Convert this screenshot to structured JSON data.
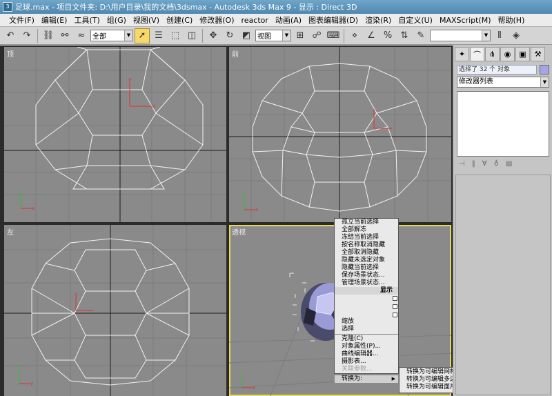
{
  "window": {
    "title": "足球.max    - 项目文件夹: D:\\用户目录\\我的文档\\3dsmax    - Autodesk 3ds Max 9    - 显示 : Direct 3D"
  },
  "menubar": {
    "items": [
      "文件(F)",
      "编辑(E)",
      "工具(T)",
      "组(G)",
      "视图(V)",
      "创建(C)",
      "修改器(O)",
      "reactor",
      "动画(A)",
      "图表编辑器(D)",
      "渲染(R)",
      "自定义(U)",
      "MAXScript(M)",
      "帮助(H)"
    ]
  },
  "toolbar": {
    "selection_filter": "全部",
    "coord_system": "视图",
    "named_selection": ""
  },
  "viewports": {
    "top": {
      "label": "顶"
    },
    "front": {
      "label": "前"
    },
    "left": {
      "label": "左"
    },
    "persp": {
      "label": "透视"
    }
  },
  "command_panel": {
    "selection_info": "选择了 32 个 对象",
    "modifier_list": "修改器列表",
    "object_color": "#a6a6e6"
  },
  "quad_menu": {
    "upper_items": [
      "孤立当前选择",
      "全部解冻",
      "冻结当前选择",
      "按名称取消隐藏",
      "全部取消隐藏",
      "隐藏未选定对象",
      "隐藏当前选择",
      "保存场景状态...",
      "管理场景状态..."
    ],
    "display_header": "显示",
    "lower_items_top": [
      "缩放",
      "选择"
    ],
    "lower_items": [
      "克隆(C)",
      "对象属性(P)...",
      "曲线编辑器...",
      "摄影表...",
      "关联参数..."
    ],
    "disabled_item": "关联参数...",
    "convert_item": "转换为:",
    "convert_submenu": [
      "转换为可编辑网格",
      "转换为可编辑多边形",
      "转换为可编辑面片"
    ]
  },
  "icons": {
    "undo": "undo-icon",
    "redo": "redo-icon",
    "select": "select-arrow-icon",
    "move": "move-icon",
    "rotate": "rotate-icon",
    "scale": "scale-icon"
  }
}
